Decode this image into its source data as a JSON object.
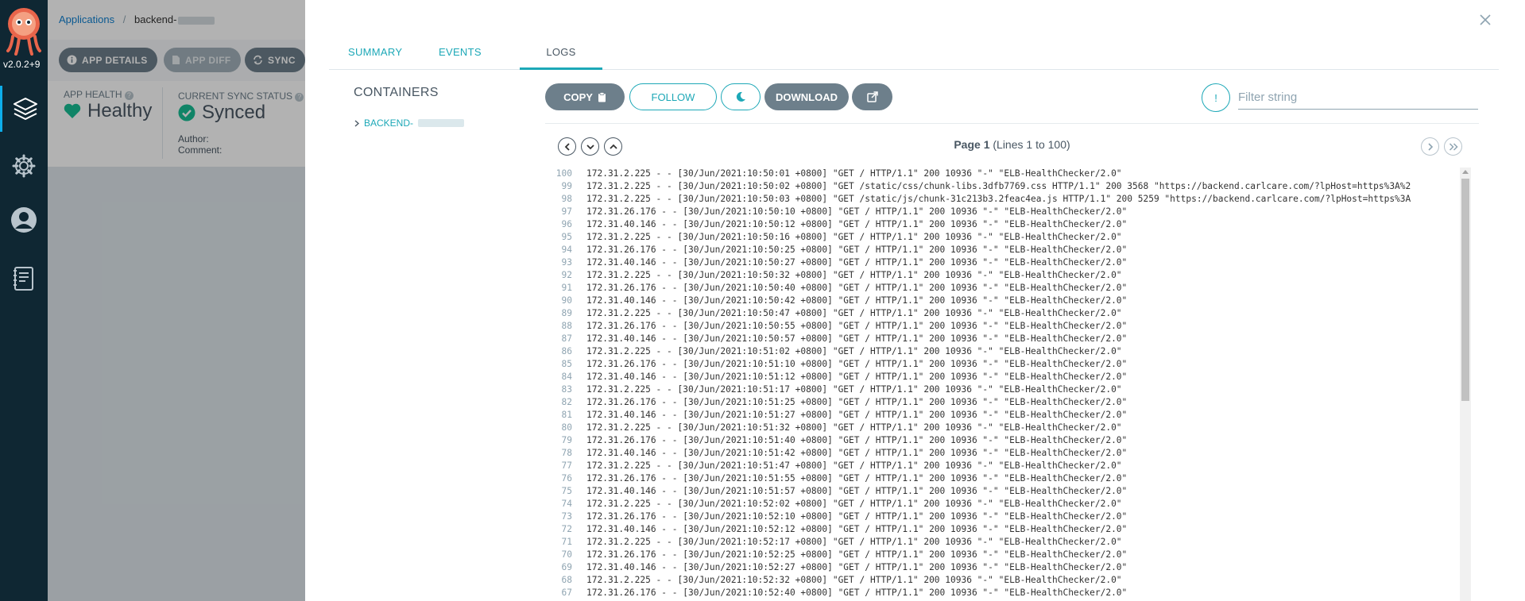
{
  "nav": {
    "version": "v2.0.2+9",
    "items": [
      {
        "name": "applications",
        "icon": "layers-icon"
      },
      {
        "name": "settings",
        "icon": "gear-icon"
      },
      {
        "name": "user-info",
        "icon": "user-icon"
      },
      {
        "name": "documentation",
        "icon": "docs-icon"
      }
    ]
  },
  "breadcrumb": {
    "applications": "Applications",
    "separator": "/",
    "current": "backend-"
  },
  "toolbar": {
    "app_details": "APP DETAILS",
    "app_diff": "APP DIFF",
    "sync": "SYNC"
  },
  "status": {
    "health_label": "APP HEALTH",
    "health_value": "Healthy",
    "sync_label": "CURRENT SYNC STATUS",
    "sync_value": "Synced",
    "author_label": "Author:",
    "comment_label": "Comment:"
  },
  "panel": {
    "tabs": [
      "SUMMARY",
      "EVENTS",
      "LOGS"
    ],
    "active_tab": "LOGS",
    "containers_title": "CONTAINERS",
    "container_name": "BACKEND-",
    "buttons": {
      "copy": "COPY",
      "follow": "FOLLOW",
      "download": "DOWNLOAD"
    },
    "filter_icon": "!",
    "filter_placeholder": "Filter string",
    "page_info_prefix": "Page 1",
    "page_info_suffix": " (Lines 1 to 100)"
  },
  "colors": {
    "accent": "#1da8b7",
    "nav_bg": "#0f2733",
    "healthy": "#18be94",
    "button": "#6d7f8b"
  },
  "logs": [
    {
      "n": "100",
      "t": "172.31.2.225 - - [30/Jun/2021:10:50:01 +0800] \"GET / HTTP/1.1\" 200 10936 \"-\" \"ELB-HealthChecker/2.0\""
    },
    {
      "n": "99",
      "t": "172.31.2.225 - - [30/Jun/2021:10:50:02 +0800] \"GET /static/css/chunk-libs.3dfb7769.css HTTP/1.1\" 200 3568 \"https://backend.carlcare.com/?lpHost=https%3A%2"
    },
    {
      "n": "98",
      "t": "172.31.2.225 - - [30/Jun/2021:10:50:03 +0800] \"GET /static/js/chunk-31c213b3.2feac4ea.js HTTP/1.1\" 200 5259 \"https://backend.carlcare.com/?lpHost=https%3A"
    },
    {
      "n": "97",
      "t": "172.31.26.176 - - [30/Jun/2021:10:50:10 +0800] \"GET / HTTP/1.1\" 200 10936 \"-\" \"ELB-HealthChecker/2.0\""
    },
    {
      "n": "96",
      "t": "172.31.40.146 - - [30/Jun/2021:10:50:12 +0800] \"GET / HTTP/1.1\" 200 10936 \"-\" \"ELB-HealthChecker/2.0\""
    },
    {
      "n": "95",
      "t": "172.31.2.225 - - [30/Jun/2021:10:50:16 +0800] \"GET / HTTP/1.1\" 200 10936 \"-\" \"ELB-HealthChecker/2.0\""
    },
    {
      "n": "94",
      "t": "172.31.26.176 - - [30/Jun/2021:10:50:25 +0800] \"GET / HTTP/1.1\" 200 10936 \"-\" \"ELB-HealthChecker/2.0\""
    },
    {
      "n": "93",
      "t": "172.31.40.146 - - [30/Jun/2021:10:50:27 +0800] \"GET / HTTP/1.1\" 200 10936 \"-\" \"ELB-HealthChecker/2.0\""
    },
    {
      "n": "92",
      "t": "172.31.2.225 - - [30/Jun/2021:10:50:32 +0800] \"GET / HTTP/1.1\" 200 10936 \"-\" \"ELB-HealthChecker/2.0\""
    },
    {
      "n": "91",
      "t": "172.31.26.176 - - [30/Jun/2021:10:50:40 +0800] \"GET / HTTP/1.1\" 200 10936 \"-\" \"ELB-HealthChecker/2.0\""
    },
    {
      "n": "90",
      "t": "172.31.40.146 - - [30/Jun/2021:10:50:42 +0800] \"GET / HTTP/1.1\" 200 10936 \"-\" \"ELB-HealthChecker/2.0\""
    },
    {
      "n": "89",
      "t": "172.31.2.225 - - [30/Jun/2021:10:50:47 +0800] \"GET / HTTP/1.1\" 200 10936 \"-\" \"ELB-HealthChecker/2.0\""
    },
    {
      "n": "88",
      "t": "172.31.26.176 - - [30/Jun/2021:10:50:55 +0800] \"GET / HTTP/1.1\" 200 10936 \"-\" \"ELB-HealthChecker/2.0\""
    },
    {
      "n": "87",
      "t": "172.31.40.146 - - [30/Jun/2021:10:50:57 +0800] \"GET / HTTP/1.1\" 200 10936 \"-\" \"ELB-HealthChecker/2.0\""
    },
    {
      "n": "86",
      "t": "172.31.2.225 - - [30/Jun/2021:10:51:02 +0800] \"GET / HTTP/1.1\" 200 10936 \"-\" \"ELB-HealthChecker/2.0\""
    },
    {
      "n": "85",
      "t": "172.31.26.176 - - [30/Jun/2021:10:51:10 +0800] \"GET / HTTP/1.1\" 200 10936 \"-\" \"ELB-HealthChecker/2.0\""
    },
    {
      "n": "84",
      "t": "172.31.40.146 - - [30/Jun/2021:10:51:12 +0800] \"GET / HTTP/1.1\" 200 10936 \"-\" \"ELB-HealthChecker/2.0\""
    },
    {
      "n": "83",
      "t": "172.31.2.225 - - [30/Jun/2021:10:51:17 +0800] \"GET / HTTP/1.1\" 200 10936 \"-\" \"ELB-HealthChecker/2.0\""
    },
    {
      "n": "82",
      "t": "172.31.26.176 - - [30/Jun/2021:10:51:25 +0800] \"GET / HTTP/1.1\" 200 10936 \"-\" \"ELB-HealthChecker/2.0\""
    },
    {
      "n": "81",
      "t": "172.31.40.146 - - [30/Jun/2021:10:51:27 +0800] \"GET / HTTP/1.1\" 200 10936 \"-\" \"ELB-HealthChecker/2.0\""
    },
    {
      "n": "80",
      "t": "172.31.2.225 - - [30/Jun/2021:10:51:32 +0800] \"GET / HTTP/1.1\" 200 10936 \"-\" \"ELB-HealthChecker/2.0\""
    },
    {
      "n": "79",
      "t": "172.31.26.176 - - [30/Jun/2021:10:51:40 +0800] \"GET / HTTP/1.1\" 200 10936 \"-\" \"ELB-HealthChecker/2.0\""
    },
    {
      "n": "78",
      "t": "172.31.40.146 - - [30/Jun/2021:10:51:42 +0800] \"GET / HTTP/1.1\" 200 10936 \"-\" \"ELB-HealthChecker/2.0\""
    },
    {
      "n": "77",
      "t": "172.31.2.225 - - [30/Jun/2021:10:51:47 +0800] \"GET / HTTP/1.1\" 200 10936 \"-\" \"ELB-HealthChecker/2.0\""
    },
    {
      "n": "76",
      "t": "172.31.26.176 - - [30/Jun/2021:10:51:55 +0800] \"GET / HTTP/1.1\" 200 10936 \"-\" \"ELB-HealthChecker/2.0\""
    },
    {
      "n": "75",
      "t": "172.31.40.146 - - [30/Jun/2021:10:51:57 +0800] \"GET / HTTP/1.1\" 200 10936 \"-\" \"ELB-HealthChecker/2.0\""
    },
    {
      "n": "74",
      "t": "172.31.2.225 - - [30/Jun/2021:10:52:02 +0800] \"GET / HTTP/1.1\" 200 10936 \"-\" \"ELB-HealthChecker/2.0\""
    },
    {
      "n": "73",
      "t": "172.31.26.176 - - [30/Jun/2021:10:52:10 +0800] \"GET / HTTP/1.1\" 200 10936 \"-\" \"ELB-HealthChecker/2.0\""
    },
    {
      "n": "72",
      "t": "172.31.40.146 - - [30/Jun/2021:10:52:12 +0800] \"GET / HTTP/1.1\" 200 10936 \"-\" \"ELB-HealthChecker/2.0\""
    },
    {
      "n": "71",
      "t": "172.31.2.225 - - [30/Jun/2021:10:52:17 +0800] \"GET / HTTP/1.1\" 200 10936 \"-\" \"ELB-HealthChecker/2.0\""
    },
    {
      "n": "70",
      "t": "172.31.26.176 - - [30/Jun/2021:10:52:25 +0800] \"GET / HTTP/1.1\" 200 10936 \"-\" \"ELB-HealthChecker/2.0\""
    },
    {
      "n": "69",
      "t": "172.31.40.146 - - [30/Jun/2021:10:52:27 +0800] \"GET / HTTP/1.1\" 200 10936 \"-\" \"ELB-HealthChecker/2.0\""
    },
    {
      "n": "68",
      "t": "172.31.2.225 - - [30/Jun/2021:10:52:32 +0800] \"GET / HTTP/1.1\" 200 10936 \"-\" \"ELB-HealthChecker/2.0\""
    },
    {
      "n": "67",
      "t": "172.31.26.176 - - [30/Jun/2021:10:52:40 +0800] \"GET / HTTP/1.1\" 200 10936 \"-\" \"ELB-HealthChecker/2.0\""
    }
  ]
}
